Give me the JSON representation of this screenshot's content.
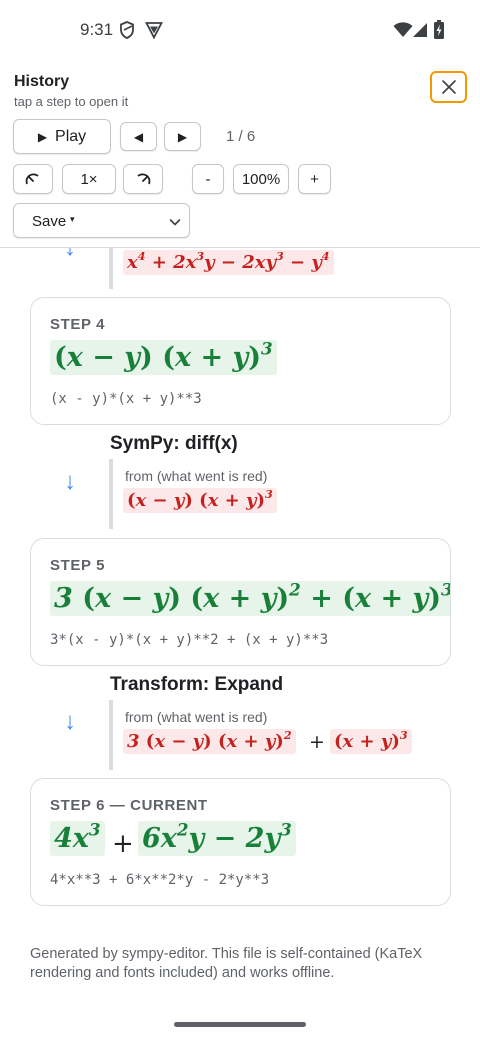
{
  "status_bar": {
    "time": "9:31"
  },
  "header": {
    "title": "History",
    "subtitle": "tap a step to open it"
  },
  "controls": {
    "play_label": "Play",
    "play_icon": "▶",
    "prev_icon": "◀",
    "next_icon": "▶",
    "counter": "1 / 6",
    "speed": "1×",
    "zoom_out": "-",
    "zoom": "100%",
    "zoom_in": "+",
    "save_label": "Save",
    "save_caret": "▾"
  },
  "timeline": {
    "top_partial": {
      "arrow": "↓",
      "expr_html": "x<sup>4</sup> + 2x<sup>3</sup>y − 2xy<sup>3</sup> − y<sup>4</sup>"
    },
    "steps": [
      {
        "label": "STEP 4",
        "expr_html": "<span class='paren'>(</span>x − y<span class='paren'>)</span> <span class='paren'>(</span>x + y<span class='paren'>)</span><sup>3</sup>",
        "code": "(x - y)*(x + y)**3"
      },
      {
        "label": "STEP 5",
        "expr_html": "3 <span class='paren'>(</span>x − y<span class='paren'>)</span> <span class='paren'>(</span>x + y<span class='paren'>)</span><sup>2</sup> + <span class='paren'>(</span>x + y<span class='paren'>)</span><sup>3</sup>",
        "code": "3*(x - y)*(x + y)**2 + (x + y)**3"
      },
      {
        "label": "STEP 6 — CURRENT",
        "code": "4*x**3 + 6*x**2*y - 2*y**3"
      }
    ],
    "transitions": [
      {
        "title": "SymPy: diff(x)",
        "arrow": "↓",
        "from_label": "from (what went is red)",
        "expr_html": "<span class='paren'>(</span>x − y<span class='paren'>)</span> <span class='paren'>(</span>x + y<span class='paren'>)</span><sup>3</sup>"
      },
      {
        "title": "Transform: Expand",
        "arrow": "↓",
        "from_label": "from (what went is red)",
        "expr_a_html": "3 <span class='paren'>(</span>x − y<span class='paren'>)</span> <span class='paren'>(</span>x + y<span class='paren'>)</span><sup>2</sup>",
        "op": "+",
        "expr_b_html": "<span class='paren'>(</span>x + y<span class='paren'>)</span><sup>3</sup>"
      }
    ],
    "current_terms": {
      "a_html": "4x<sup>3</sup>",
      "op": "+",
      "b_html": "6x<sup>2</sup>y − 2y<sup>3</sup>"
    }
  },
  "footer": "Generated by sympy-editor. This file is self-contained (KaTeX rendering and fonts included) and works offline.",
  "colors": {
    "accent_focus": "#f29900",
    "added_bg": "#e6f4ea",
    "added_text": "#188038",
    "removed_bg": "#fce8e9",
    "removed_text": "#c5221f",
    "arrow": "#4285f4"
  }
}
